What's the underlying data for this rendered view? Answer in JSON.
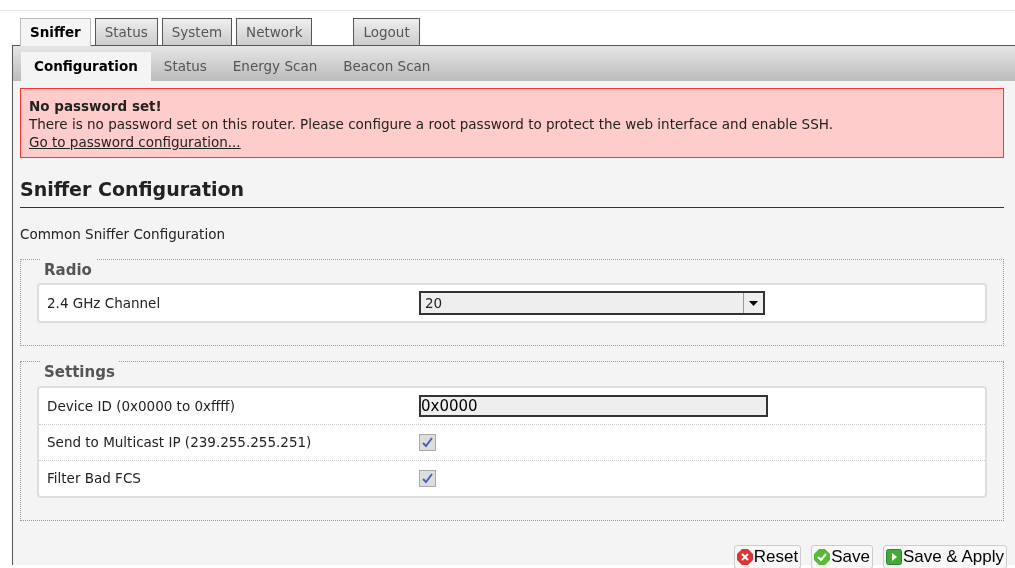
{
  "tabs": [
    {
      "label": "Sniffer",
      "selected": true
    },
    {
      "label": "Status",
      "selected": false
    },
    {
      "label": "System",
      "selected": false
    },
    {
      "label": "Network",
      "selected": false
    },
    {
      "label": "Logout",
      "selected": false
    }
  ],
  "subtabs": [
    {
      "label": "Configuration",
      "selected": true
    },
    {
      "label": "Status",
      "selected": false
    },
    {
      "label": "Energy Scan",
      "selected": false
    },
    {
      "label": "Beacon Scan",
      "selected": false
    }
  ],
  "alert": {
    "title": "No password set!",
    "message": "There is no password set on this router. Please configure a root password to protect the web interface and enable SSH.",
    "link": "Go to password configuration..."
  },
  "heading": "Sniffer Configuration",
  "description": "Common Sniffer Configuration",
  "sections": [
    {
      "legend": "Radio",
      "fields": [
        {
          "kind": "select",
          "label": "2.4 GHz Channel",
          "value": "20"
        }
      ]
    },
    {
      "legend": "Settings",
      "fields": [
        {
          "kind": "text",
          "label": "Device ID (0x0000 to 0xffff)",
          "value": "0x0000"
        },
        {
          "kind": "checkbox",
          "label": "Send to Multicast IP (239.255.255.251)",
          "checked": true
        },
        {
          "kind": "checkbox",
          "label": "Filter Bad FCS",
          "checked": true
        }
      ]
    }
  ],
  "buttons": [
    {
      "kind": "reset",
      "label": "Reset"
    },
    {
      "kind": "save",
      "label": "Save"
    },
    {
      "kind": "apply",
      "label": "Save & Apply"
    }
  ]
}
